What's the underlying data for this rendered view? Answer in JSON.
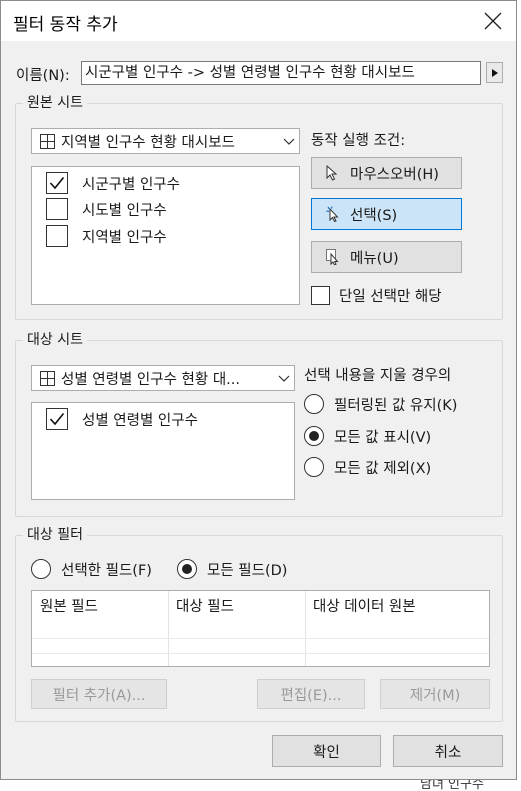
{
  "dialog": {
    "title": "필터 동작 추가",
    "close_icon": "close-icon"
  },
  "name": {
    "label": "이름(N):",
    "value": "시군구별 인구수 -> 성별 연령별 인구수 현황 대시보드",
    "arrow_icon": "triangle-right-icon"
  },
  "source_sheets": {
    "group_label": "원본 시트",
    "dashboard_select": "지역별 인구수 현황 대시보드",
    "items": [
      {
        "label": "시군구별 인구수",
        "checked": true
      },
      {
        "label": "시도별 인구수",
        "checked": false
      },
      {
        "label": "지역별 인구수",
        "checked": false
      }
    ]
  },
  "run_action": {
    "label": "동작 실행 조건:",
    "hover_button": "마우스오버(H)",
    "select_button": "선택(S)",
    "menu_button": "메뉴(U)",
    "single_select_label": "단일 선택만 해당",
    "selected": "select"
  },
  "target_sheets": {
    "group_label": "대상 시트",
    "dashboard_select": "성별 연령별 인구수 현황 대...",
    "items": [
      {
        "label": "성별 연령별 인구수",
        "checked": true
      }
    ]
  },
  "clearing_selection": {
    "label": "선택 내용을 지울 경우의",
    "options": [
      {
        "label": "필터링된 값 유지(K)",
        "selected": false
      },
      {
        "label": "모든 값 표시(V)",
        "selected": true
      },
      {
        "label": "모든 값 제외(X)",
        "selected": false
      }
    ]
  },
  "target_filters": {
    "group_label": "대상 필터",
    "selected_fields_label": "선택한 필드(F)",
    "all_fields_label": "모든 필드(D)",
    "all_fields_selected": true,
    "columns": [
      "원본 필드",
      "대상 필드",
      "대상 데이터 원본"
    ],
    "add_filter_button": "필터 추가(A)...",
    "edit_button": "편집(E)...",
    "remove_button": "제거(M)"
  },
  "footer": {
    "ok_button": "확인",
    "cancel_button": "취소"
  },
  "background": {
    "partial_text": "남녀 인구수"
  }
}
